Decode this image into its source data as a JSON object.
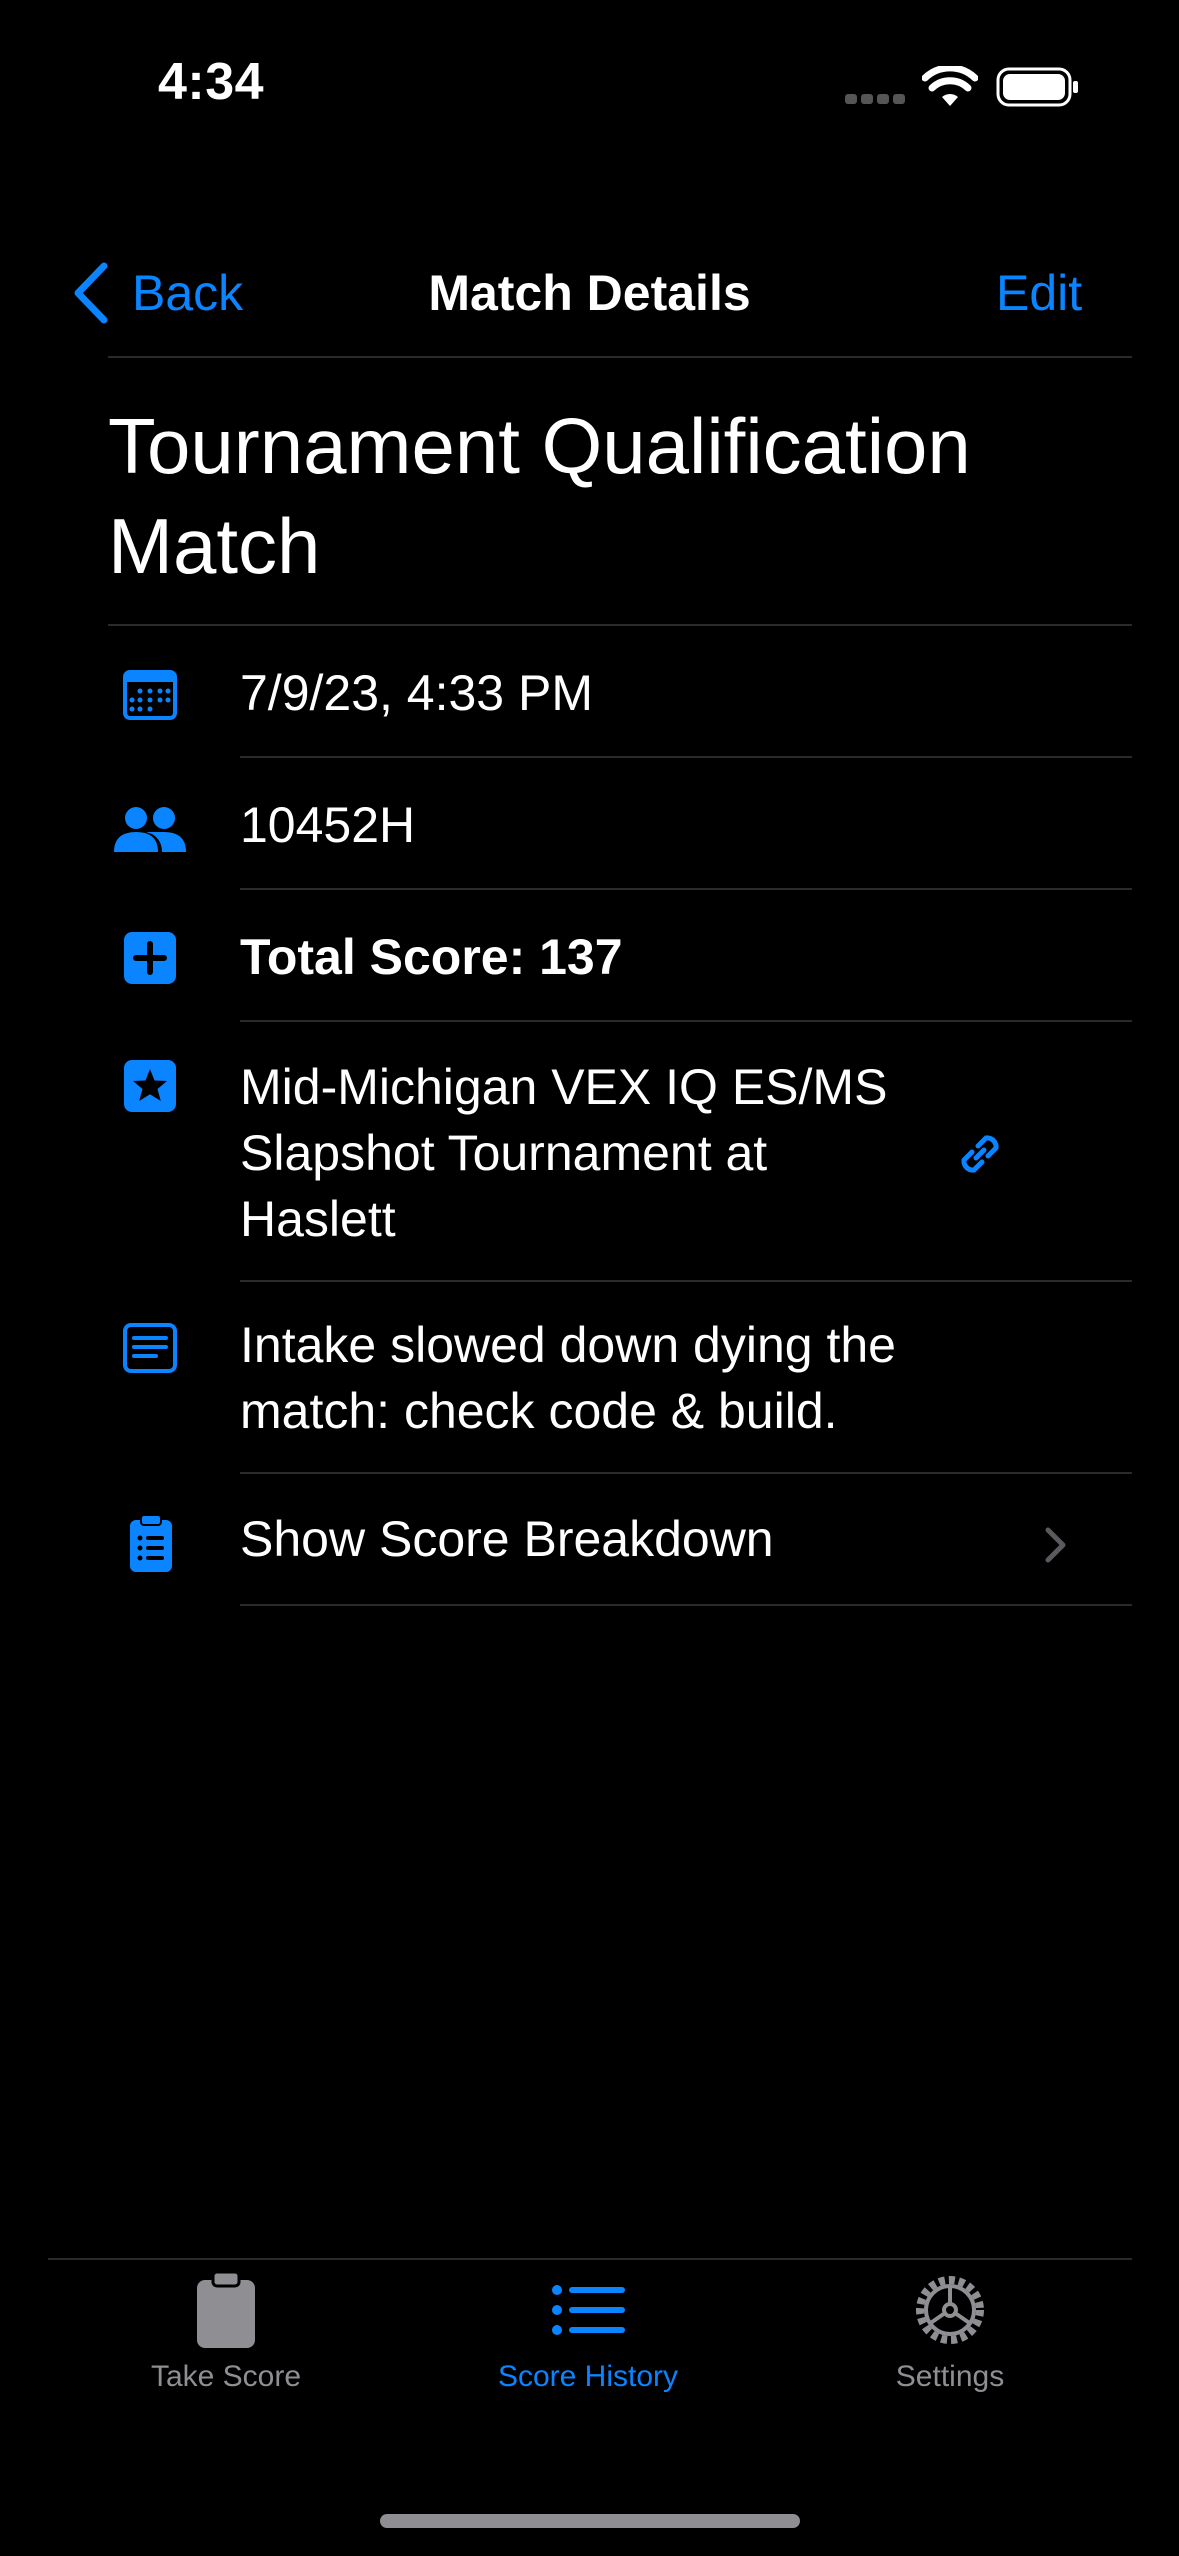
{
  "status_bar": {
    "time": "4:34"
  },
  "nav": {
    "back_label": "Back",
    "title": "Match Details",
    "edit_label": "Edit"
  },
  "match": {
    "title": "Tournament Qualification Match",
    "date": "7/9/23, 4:33 PM",
    "team": "10452H",
    "total_score": "Total Score: 137",
    "tournament_line1": "Mid-Michigan VEX IQ ES/MS",
    "tournament_line2": "Slapshot Tournament at",
    "tournament_line3": "Haslett",
    "notes_line1": "Intake slowed down dying the",
    "notes_line2": "match: check code & build.",
    "breakdown_label": "Show Score Breakdown"
  },
  "tab_bar": {
    "items": [
      {
        "label": "Take Score",
        "icon": "clipboard-icon",
        "selected": false
      },
      {
        "label": "Score History",
        "icon": "list-icon",
        "selected": true
      },
      {
        "label": "Settings",
        "icon": "gear-icon",
        "selected": false
      }
    ]
  },
  "colors": {
    "accent": "#0A84FF",
    "background": "#000000",
    "separator": "#2a2a2c",
    "inactive": "#8e8e93"
  }
}
